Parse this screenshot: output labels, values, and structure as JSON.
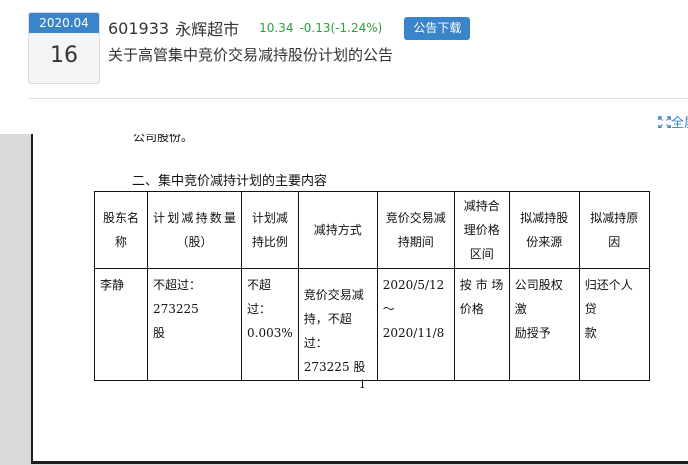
{
  "announcement": {
    "date_month": "2020.04",
    "date_day": "16",
    "stock_code": "601933",
    "stock_name": "永辉超市",
    "price": "10.34",
    "change": "-0.13(-1.24%)",
    "download_label": "公告下载",
    "title": "关于高管集中竞价交易减持股份计划的公告",
    "fullscreen_label": "全屏"
  },
  "colors": {
    "accent": "#3a85c9",
    "down": "#2da041"
  },
  "document": {
    "fragment_text": "公司股份。",
    "section_title": "二、集中竞价减持计划的主要内容",
    "page_number": "1",
    "table": {
      "headers": [
        [
          "股东名",
          "称"
        ],
        [
          "计划减持数量",
          "（股）"
        ],
        [
          "计划减",
          "持比例"
        ],
        [
          "减持方式"
        ],
        [
          "竞价交易减",
          "持期间"
        ],
        [
          "减持合",
          "理价格",
          "区间"
        ],
        [
          "拟减持股",
          "份来源"
        ],
        [
          "拟减持原",
          "因"
        ]
      ],
      "row": [
        [
          "李静"
        ],
        [
          "不超过：273225",
          "股"
        ],
        [
          "不超过：",
          "0.003%"
        ],
        [
          "竞价交易减",
          "持，不超过：",
          "273225 股"
        ],
        [
          "2020/5/12～",
          "2020/11/8"
        ],
        [
          "按 市 场",
          "价格"
        ],
        [
          "公司股权激",
          "励授予"
        ],
        [
          "归还个人贷",
          "款"
        ]
      ]
    }
  }
}
